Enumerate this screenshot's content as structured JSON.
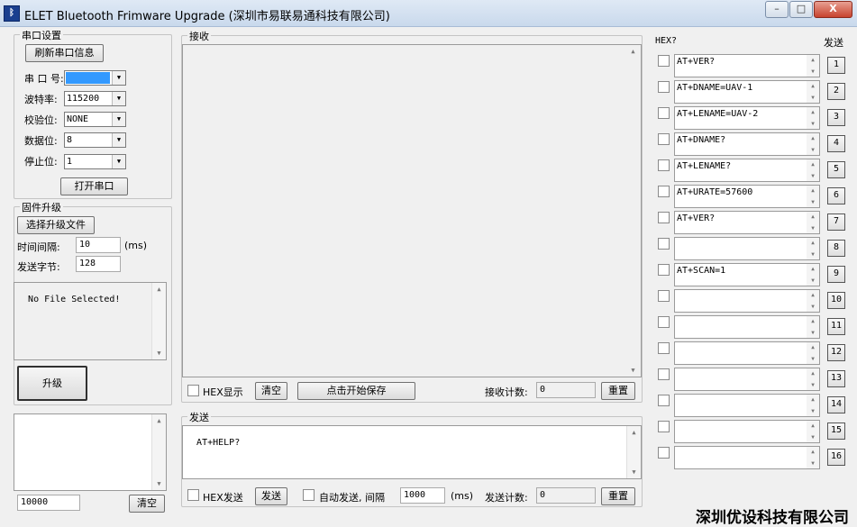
{
  "title": {
    "app_icon": "bluetooth-app-icon",
    "text": "ELET Bluetooth Frimware Upgrade (深圳市易联易通科技有限公司)"
  },
  "window_controls": {
    "minimize": "–",
    "maximize": "□",
    "close": "X"
  },
  "serial": {
    "legend": "串口设置",
    "refresh_label": "刷新串口信息",
    "port_label": "串 口 号:",
    "port_value": "",
    "baud_label": "波特率:",
    "baud_value": "115200",
    "parity_label": "校验位:",
    "parity_value": "NONE",
    "databits_label": "数据位:",
    "databits_value": "8",
    "stopbits_label": "停止位:",
    "stopbits_value": "1",
    "open_label": "打开串口"
  },
  "firmware": {
    "legend": "固件升级",
    "select_label": "选择升级文件",
    "interval_label": "时间间隔:",
    "interval_value": "10",
    "interval_unit": "(ms)",
    "bytes_label": "发送字节:",
    "bytes_value": "128",
    "file_status": "No File Selected!",
    "upgrade_label": "升级"
  },
  "log": {
    "text": "",
    "counter_value": "10000",
    "clear_label": "清空"
  },
  "receive": {
    "legend": "接收",
    "text": "",
    "hex_display_label": "HEX显示",
    "clear_label": "清空",
    "save_label": "点击开始保存",
    "count_label": "接收计数:",
    "count_value": "0",
    "reset_label": "重置"
  },
  "send": {
    "legend": "发送",
    "text": "AT+HELP?",
    "hex_send_label": "HEX发送",
    "send_label": "发送",
    "auto_label": "自动发送, 间隔",
    "interval_value": "1000",
    "interval_unit": "(ms)",
    "count_label": "发送计数:",
    "count_value": "0",
    "reset_label": "重置"
  },
  "commands": {
    "hex_header": "HEX?",
    "send_header": "发送",
    "items": [
      {
        "cmd": "AT+VER?",
        "btn": "1"
      },
      {
        "cmd": "AT+DNAME=UAV-1",
        "btn": "2"
      },
      {
        "cmd": "AT+LENAME=UAV-2",
        "btn": "3"
      },
      {
        "cmd": "AT+DNAME?",
        "btn": "4"
      },
      {
        "cmd": "AT+LENAME?",
        "btn": "5"
      },
      {
        "cmd": "AT+URATE=57600",
        "btn": "6"
      },
      {
        "cmd": "AT+VER?",
        "btn": "7"
      },
      {
        "cmd": "",
        "btn": "8"
      },
      {
        "cmd": "AT+SCAN=1",
        "btn": "9"
      },
      {
        "cmd": "",
        "btn": "10"
      },
      {
        "cmd": "",
        "btn": "11"
      },
      {
        "cmd": "",
        "btn": "12"
      },
      {
        "cmd": "",
        "btn": "13"
      },
      {
        "cmd": "",
        "btn": "14"
      },
      {
        "cmd": "",
        "btn": "15"
      },
      {
        "cmd": "",
        "btn": "16"
      }
    ]
  },
  "watermark": "深圳优设科技有限公司",
  "colors": {
    "selection": "#3399ff",
    "window_bg": "#f0f0f0",
    "title_bar": "#c9d9ec"
  }
}
